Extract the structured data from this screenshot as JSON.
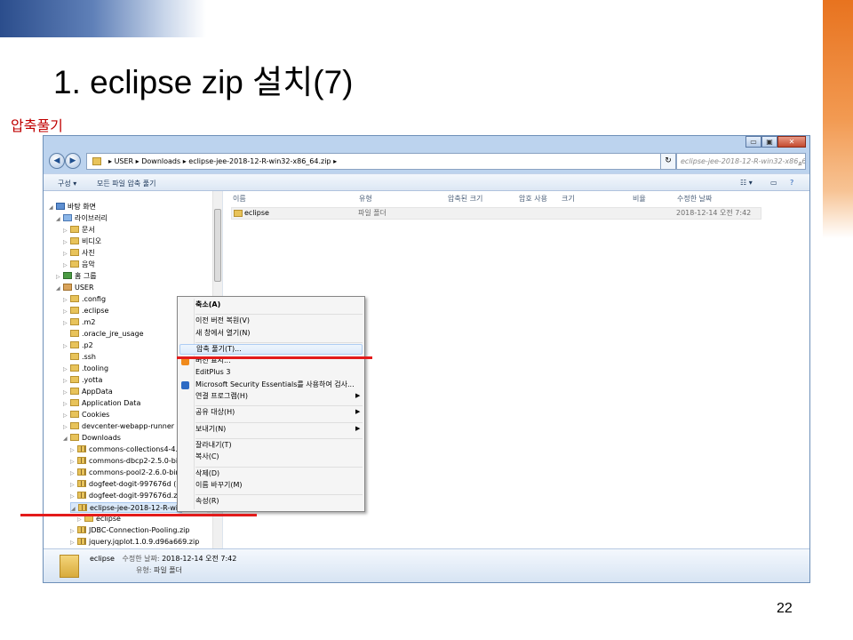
{
  "slide": {
    "title": "1. eclipse zip 설치(7)",
    "subtitle": "압축풀기",
    "page_number": "22"
  },
  "window": {
    "controls": {
      "minimize": "▭",
      "maximize": "▣",
      "close": "✕"
    },
    "address_segments": [
      "USER",
      "Downloads",
      "eclipse-jee-2018-12-R-win32-x86_64.zip"
    ],
    "search_placeholder": "eclipse-jee-2018-12-R-win32-x86_6...",
    "toolbar": {
      "organize": "구성 ▾",
      "extract_all": "모든 파일 압축 풀기"
    },
    "columns": [
      "이름",
      "유형",
      "압축된 크기",
      "암호 사용",
      "크기",
      "비율",
      "수정한 날짜"
    ],
    "file": {
      "name": "eclipse",
      "type": "파일 폴더",
      "modified": "2018-12-14 오전 7:42"
    },
    "tree": [
      {
        "label": "바탕 화면",
        "indent": 0,
        "exp": "◢",
        "icon": "blue"
      },
      {
        "label": "라이브러리",
        "indent": 1,
        "exp": "◢",
        "icon": "lib"
      },
      {
        "label": "문서",
        "indent": 2,
        "exp": "▷",
        "icon": "doc"
      },
      {
        "label": "비디오",
        "indent": 2,
        "exp": "▷",
        "icon": "video"
      },
      {
        "label": "사진",
        "indent": 2,
        "exp": "▷",
        "icon": "pic"
      },
      {
        "label": "음악",
        "indent": 2,
        "exp": "▷",
        "icon": "music"
      },
      {
        "label": "홈 그룹",
        "indent": 1,
        "exp": "▷",
        "icon": "hg"
      },
      {
        "label": "USER",
        "indent": 1,
        "exp": "◢",
        "icon": "user"
      },
      {
        "label": ".config",
        "indent": 2,
        "exp": "▷",
        "icon": "folder"
      },
      {
        "label": ".eclipse",
        "indent": 2,
        "exp": "▷",
        "icon": "folder"
      },
      {
        "label": ".m2",
        "indent": 2,
        "exp": "▷",
        "icon": "folder"
      },
      {
        "label": ".oracle_jre_usage",
        "indent": 2,
        "exp": "",
        "icon": "folder"
      },
      {
        "label": ".p2",
        "indent": 2,
        "exp": "▷",
        "icon": "folder"
      },
      {
        "label": ".ssh",
        "indent": 2,
        "exp": "",
        "icon": "folder"
      },
      {
        "label": ".tooling",
        "indent": 2,
        "exp": "▷",
        "icon": "folder"
      },
      {
        "label": ".yotta",
        "indent": 2,
        "exp": "▷",
        "icon": "folder"
      },
      {
        "label": "AppData",
        "indent": 2,
        "exp": "▷",
        "icon": "folder"
      },
      {
        "label": "Application Data",
        "indent": 2,
        "exp": "▷",
        "icon": "folder"
      },
      {
        "label": "Cookies",
        "indent": 2,
        "exp": "▷",
        "icon": "folder"
      },
      {
        "label": "devcenter-webapp-runner",
        "indent": 2,
        "exp": "▷",
        "icon": "folder"
      },
      {
        "label": "Downloads",
        "indent": 2,
        "exp": "◢",
        "icon": "folder"
      },
      {
        "label": "commons-collections4-4.2-bin",
        "indent": 3,
        "exp": "▷",
        "icon": "zip"
      },
      {
        "label": "commons-dbcp2-2.5.0-bin.zip",
        "indent": 3,
        "exp": "▷",
        "icon": "zip"
      },
      {
        "label": "commons-pool2-2.6.0-bin.zip",
        "indent": 3,
        "exp": "▷",
        "icon": "zip"
      },
      {
        "label": "dogfeet-dogit-997676d (1).zip",
        "indent": 3,
        "exp": "▷",
        "icon": "zip"
      },
      {
        "label": "dogfeet-dogit-997676d.zip",
        "indent": 3,
        "exp": "▷",
        "icon": "zip"
      },
      {
        "label": "eclipse-jee-2018-12-R-win32-x86_64.zip",
        "indent": 3,
        "exp": "◢",
        "icon": "zip",
        "selected": true
      },
      {
        "label": "eclipse",
        "indent": 4,
        "exp": "▷",
        "icon": "folder"
      },
      {
        "label": "JDBC-Connection-Pooling.zip",
        "indent": 3,
        "exp": "▷",
        "icon": "zip"
      },
      {
        "label": "jquery.jqplot.1.0.9.d96a669.zip",
        "indent": 3,
        "exp": "▷",
        "icon": "zip"
      }
    ],
    "details": {
      "name": "eclipse",
      "modified_label": "수정한 날짜:",
      "modified": "2018-12-14 오전 7:42",
      "type_label": "유형:",
      "type": "파일 폴더"
    }
  },
  "context_menu": {
    "items": [
      {
        "label": "축소(A)",
        "bold": true
      },
      {
        "separator": true
      },
      {
        "label": "이전 버전 복원(V)"
      },
      {
        "label": "새 창에서 열기(N)"
      },
      {
        "separator": true
      },
      {
        "label": "압축 풀기(T)...",
        "highlight": true
      },
      {
        "label": "버전 표시...",
        "icon": "orange"
      },
      {
        "label": "EditPlus 3"
      },
      {
        "label": "Microsoft Security Essentials를 사용하여 검사...",
        "icon": "blue"
      },
      {
        "label": "연결 프로그램(H)",
        "submenu": true
      },
      {
        "separator": true
      },
      {
        "label": "공유 대상(H)",
        "submenu": true
      },
      {
        "separator": true
      },
      {
        "label": "보내기(N)",
        "submenu": true
      },
      {
        "separator": true
      },
      {
        "label": "잘라내기(T)"
      },
      {
        "label": "복사(C)"
      },
      {
        "separator": true
      },
      {
        "label": "삭제(D)"
      },
      {
        "label": "이름 바꾸기(M)"
      },
      {
        "separator": true
      },
      {
        "label": "속성(R)"
      }
    ]
  },
  "colors": {
    "annotation_red": "#e31b1b",
    "subtitle_red": "#c00000"
  }
}
